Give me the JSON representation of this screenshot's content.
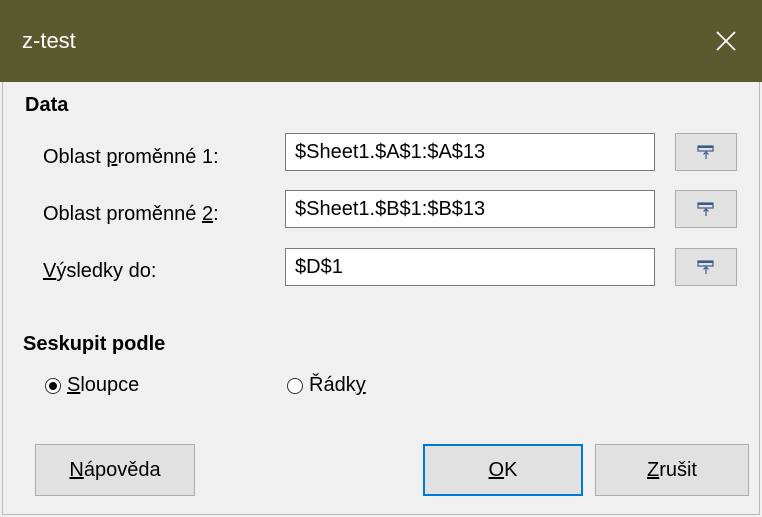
{
  "window": {
    "title": "z-test",
    "close_icon": "close-icon"
  },
  "data_section": {
    "title": "Data",
    "var1_label_pre": "Oblast ",
    "var1_label_ul": "p",
    "var1_label_post": "roměnné 1:",
    "var1_value": "$Sheet1.$A$1:$A$13",
    "var2_label_pre": "Oblast proměnné ",
    "var2_label_ul": "2",
    "var2_label_post": ":",
    "var2_value": "$Sheet1.$B$1:$B$13",
    "results_label_ul": "V",
    "results_label_post": "ýsledky do:",
    "results_value": "$D$1",
    "shrink_icon": "shrink-icon"
  },
  "group_section": {
    "title": "Seskupit podle",
    "columns_ul": "S",
    "columns_post": "loupce",
    "columns_checked": true,
    "rows_pre": "Řádk",
    "rows_ul": "y",
    "rows_checked": false
  },
  "buttons": {
    "help_ul": "N",
    "help_post": "ápověda",
    "ok_ul": "O",
    "ok_post": "K",
    "cancel_ul": "Z",
    "cancel_post": "rušit"
  }
}
